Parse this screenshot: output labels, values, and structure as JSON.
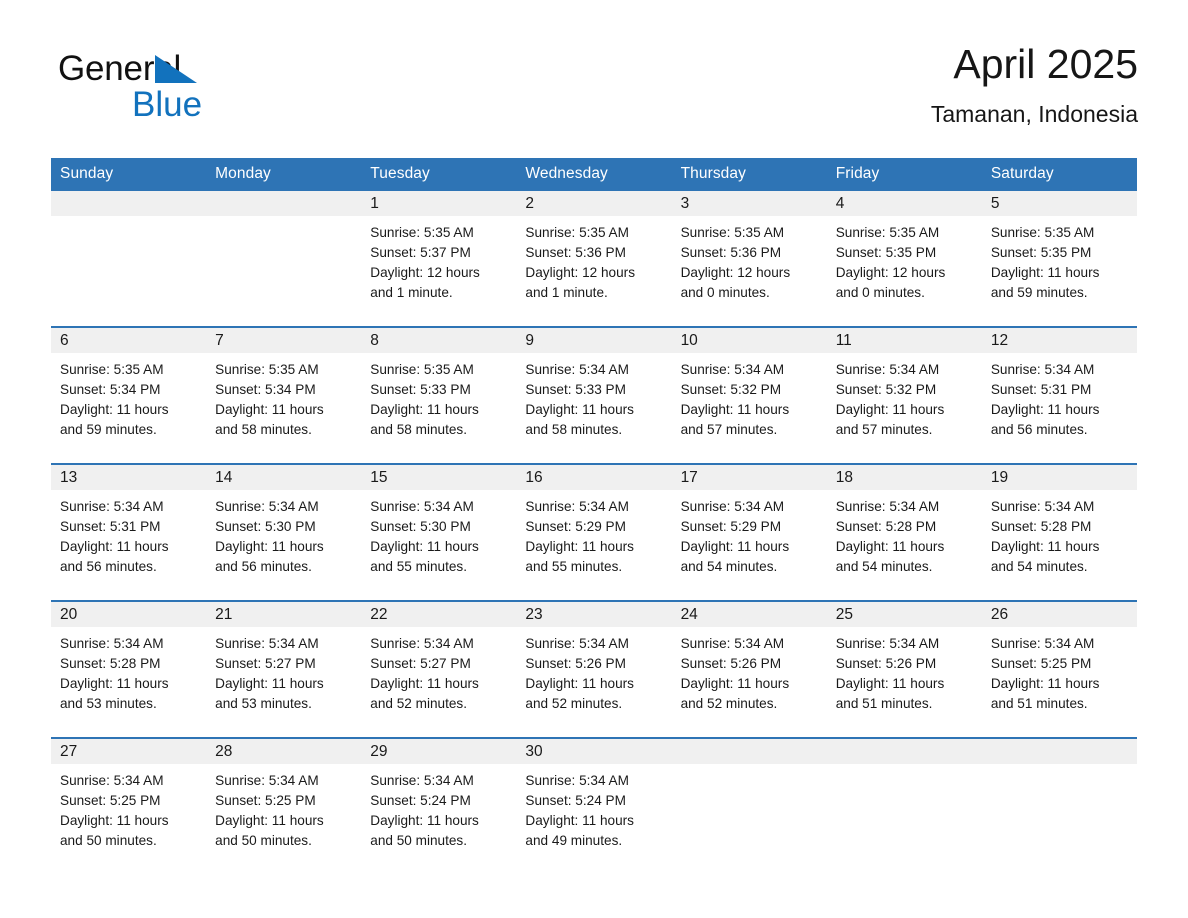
{
  "brand": {
    "name_part1": "General",
    "name_part2": "Blue",
    "flag_icon": "triangle-flag-icon",
    "accent_color": "#1272bd"
  },
  "header": {
    "title": "April 2025",
    "subtitle": "Tamanan, Indonesia"
  },
  "theme": {
    "header_blue": "#2e74b5",
    "row_divider_blue": "#2e74b5",
    "daynum_band_gray": "#f0f0f0",
    "text_color": "#1a1a1a"
  },
  "calendar": {
    "weekday_headers": [
      "Sunday",
      "Monday",
      "Tuesday",
      "Wednesday",
      "Thursday",
      "Friday",
      "Saturday"
    ],
    "weeks": [
      [
        {
          "day": "",
          "empty": true,
          "sunrise": "",
          "sunset": "",
          "daylight_line1": "",
          "daylight_line2": ""
        },
        {
          "day": "",
          "empty": true,
          "sunrise": "",
          "sunset": "",
          "daylight_line1": "",
          "daylight_line2": ""
        },
        {
          "day": "1",
          "empty": false,
          "sunrise": "Sunrise: 5:35 AM",
          "sunset": "Sunset: 5:37 PM",
          "daylight_line1": "Daylight: 12 hours",
          "daylight_line2": "and 1 minute."
        },
        {
          "day": "2",
          "empty": false,
          "sunrise": "Sunrise: 5:35 AM",
          "sunset": "Sunset: 5:36 PM",
          "daylight_line1": "Daylight: 12 hours",
          "daylight_line2": "and 1 minute."
        },
        {
          "day": "3",
          "empty": false,
          "sunrise": "Sunrise: 5:35 AM",
          "sunset": "Sunset: 5:36 PM",
          "daylight_line1": "Daylight: 12 hours",
          "daylight_line2": "and 0 minutes."
        },
        {
          "day": "4",
          "empty": false,
          "sunrise": "Sunrise: 5:35 AM",
          "sunset": "Sunset: 5:35 PM",
          "daylight_line1": "Daylight: 12 hours",
          "daylight_line2": "and 0 minutes."
        },
        {
          "day": "5",
          "empty": false,
          "sunrise": "Sunrise: 5:35 AM",
          "sunset": "Sunset: 5:35 PM",
          "daylight_line1": "Daylight: 11 hours",
          "daylight_line2": "and 59 minutes."
        }
      ],
      [
        {
          "day": "6",
          "empty": false,
          "sunrise": "Sunrise: 5:35 AM",
          "sunset": "Sunset: 5:34 PM",
          "daylight_line1": "Daylight: 11 hours",
          "daylight_line2": "and 59 minutes."
        },
        {
          "day": "7",
          "empty": false,
          "sunrise": "Sunrise: 5:35 AM",
          "sunset": "Sunset: 5:34 PM",
          "daylight_line1": "Daylight: 11 hours",
          "daylight_line2": "and 58 minutes."
        },
        {
          "day": "8",
          "empty": false,
          "sunrise": "Sunrise: 5:35 AM",
          "sunset": "Sunset: 5:33 PM",
          "daylight_line1": "Daylight: 11 hours",
          "daylight_line2": "and 58 minutes."
        },
        {
          "day": "9",
          "empty": false,
          "sunrise": "Sunrise: 5:34 AM",
          "sunset": "Sunset: 5:33 PM",
          "daylight_line1": "Daylight: 11 hours",
          "daylight_line2": "and 58 minutes."
        },
        {
          "day": "10",
          "empty": false,
          "sunrise": "Sunrise: 5:34 AM",
          "sunset": "Sunset: 5:32 PM",
          "daylight_line1": "Daylight: 11 hours",
          "daylight_line2": "and 57 minutes."
        },
        {
          "day": "11",
          "empty": false,
          "sunrise": "Sunrise: 5:34 AM",
          "sunset": "Sunset: 5:32 PM",
          "daylight_line1": "Daylight: 11 hours",
          "daylight_line2": "and 57 minutes."
        },
        {
          "day": "12",
          "empty": false,
          "sunrise": "Sunrise: 5:34 AM",
          "sunset": "Sunset: 5:31 PM",
          "daylight_line1": "Daylight: 11 hours",
          "daylight_line2": "and 56 minutes."
        }
      ],
      [
        {
          "day": "13",
          "empty": false,
          "sunrise": "Sunrise: 5:34 AM",
          "sunset": "Sunset: 5:31 PM",
          "daylight_line1": "Daylight: 11 hours",
          "daylight_line2": "and 56 minutes."
        },
        {
          "day": "14",
          "empty": false,
          "sunrise": "Sunrise: 5:34 AM",
          "sunset": "Sunset: 5:30 PM",
          "daylight_line1": "Daylight: 11 hours",
          "daylight_line2": "and 56 minutes."
        },
        {
          "day": "15",
          "empty": false,
          "sunrise": "Sunrise: 5:34 AM",
          "sunset": "Sunset: 5:30 PM",
          "daylight_line1": "Daylight: 11 hours",
          "daylight_line2": "and 55 minutes."
        },
        {
          "day": "16",
          "empty": false,
          "sunrise": "Sunrise: 5:34 AM",
          "sunset": "Sunset: 5:29 PM",
          "daylight_line1": "Daylight: 11 hours",
          "daylight_line2": "and 55 minutes."
        },
        {
          "day": "17",
          "empty": false,
          "sunrise": "Sunrise: 5:34 AM",
          "sunset": "Sunset: 5:29 PM",
          "daylight_line1": "Daylight: 11 hours",
          "daylight_line2": "and 54 minutes."
        },
        {
          "day": "18",
          "empty": false,
          "sunrise": "Sunrise: 5:34 AM",
          "sunset": "Sunset: 5:28 PM",
          "daylight_line1": "Daylight: 11 hours",
          "daylight_line2": "and 54 minutes."
        },
        {
          "day": "19",
          "empty": false,
          "sunrise": "Sunrise: 5:34 AM",
          "sunset": "Sunset: 5:28 PM",
          "daylight_line1": "Daylight: 11 hours",
          "daylight_line2": "and 54 minutes."
        }
      ],
      [
        {
          "day": "20",
          "empty": false,
          "sunrise": "Sunrise: 5:34 AM",
          "sunset": "Sunset: 5:28 PM",
          "daylight_line1": "Daylight: 11 hours",
          "daylight_line2": "and 53 minutes."
        },
        {
          "day": "21",
          "empty": false,
          "sunrise": "Sunrise: 5:34 AM",
          "sunset": "Sunset: 5:27 PM",
          "daylight_line1": "Daylight: 11 hours",
          "daylight_line2": "and 53 minutes."
        },
        {
          "day": "22",
          "empty": false,
          "sunrise": "Sunrise: 5:34 AM",
          "sunset": "Sunset: 5:27 PM",
          "daylight_line1": "Daylight: 11 hours",
          "daylight_line2": "and 52 minutes."
        },
        {
          "day": "23",
          "empty": false,
          "sunrise": "Sunrise: 5:34 AM",
          "sunset": "Sunset: 5:26 PM",
          "daylight_line1": "Daylight: 11 hours",
          "daylight_line2": "and 52 minutes."
        },
        {
          "day": "24",
          "empty": false,
          "sunrise": "Sunrise: 5:34 AM",
          "sunset": "Sunset: 5:26 PM",
          "daylight_line1": "Daylight: 11 hours",
          "daylight_line2": "and 52 minutes."
        },
        {
          "day": "25",
          "empty": false,
          "sunrise": "Sunrise: 5:34 AM",
          "sunset": "Sunset: 5:26 PM",
          "daylight_line1": "Daylight: 11 hours",
          "daylight_line2": "and 51 minutes."
        },
        {
          "day": "26",
          "empty": false,
          "sunrise": "Sunrise: 5:34 AM",
          "sunset": "Sunset: 5:25 PM",
          "daylight_line1": "Daylight: 11 hours",
          "daylight_line2": "and 51 minutes."
        }
      ],
      [
        {
          "day": "27",
          "empty": false,
          "sunrise": "Sunrise: 5:34 AM",
          "sunset": "Sunset: 5:25 PM",
          "daylight_line1": "Daylight: 11 hours",
          "daylight_line2": "and 50 minutes."
        },
        {
          "day": "28",
          "empty": false,
          "sunrise": "Sunrise: 5:34 AM",
          "sunset": "Sunset: 5:25 PM",
          "daylight_line1": "Daylight: 11 hours",
          "daylight_line2": "and 50 minutes."
        },
        {
          "day": "29",
          "empty": false,
          "sunrise": "Sunrise: 5:34 AM",
          "sunset": "Sunset: 5:24 PM",
          "daylight_line1": "Daylight: 11 hours",
          "daylight_line2": "and 50 minutes."
        },
        {
          "day": "30",
          "empty": false,
          "sunrise": "Sunrise: 5:34 AM",
          "sunset": "Sunset: 5:24 PM",
          "daylight_line1": "Daylight: 11 hours",
          "daylight_line2": "and 49 minutes."
        },
        {
          "day": "",
          "empty": true,
          "sunrise": "",
          "sunset": "",
          "daylight_line1": "",
          "daylight_line2": ""
        },
        {
          "day": "",
          "empty": true,
          "sunrise": "",
          "sunset": "",
          "daylight_line1": "",
          "daylight_line2": ""
        },
        {
          "day": "",
          "empty": true,
          "sunrise": "",
          "sunset": "",
          "daylight_line1": "",
          "daylight_line2": ""
        }
      ]
    ]
  }
}
